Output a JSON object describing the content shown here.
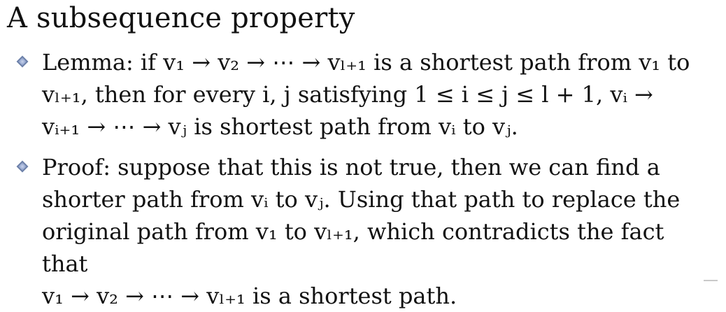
{
  "slide": {
    "title": "A subsequence property",
    "bullets": [
      {
        "lines": [
          "Lemma: if v₁ → v₂ → ⋯ → vₗ₊₁ is a shortest path from v₁ to",
          "vₗ₊₁, then for every i, j satisfying 1 ≤ i ≤ j ≤ l + 1, vᵢ →",
          "vᵢ₊₁ → ⋯ → vⱼ is shortest path from vᵢ to vⱼ."
        ]
      },
      {
        "lines": [
          "Proof: suppose that this is not true, then we can find a",
          "shorter path from vᵢ to vⱼ. Using that path to replace the",
          "original path from v₁ to vₗ₊₁, which contradicts the fact that",
          "v₁ → v₂ → ⋯ → vₗ₊₁ is a shortest path."
        ]
      }
    ]
  },
  "colors": {
    "text": "#111111",
    "background": "#ffffff",
    "bullet_marker": "#7f92bf"
  },
  "icons": {
    "bullet": "diamond-bullet-icon"
  }
}
